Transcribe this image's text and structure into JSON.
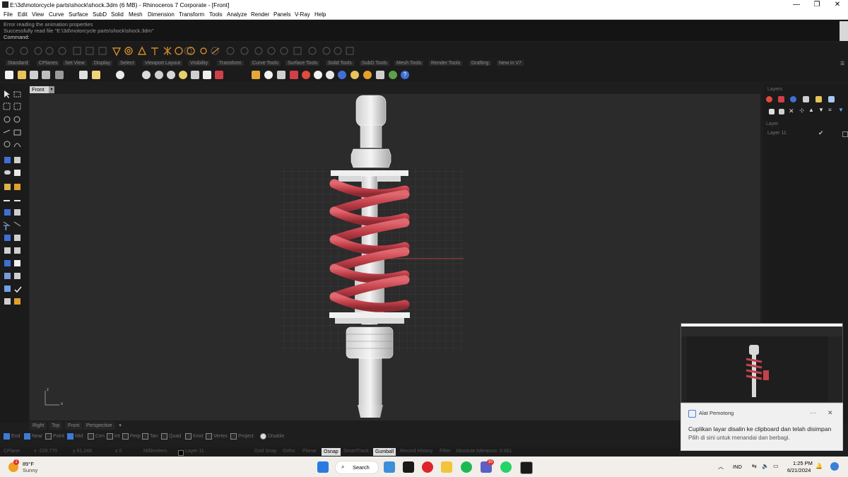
{
  "window": {
    "title": "E:\\3d\\motorcycle parts\\shock\\shock.3dm (6 MB) - Rhinoceros 7 Corporate - [Front]",
    "controls": {
      "minimize": "—",
      "restore": "❐",
      "close": "✕"
    }
  },
  "menu": [
    "File",
    "Edit",
    "View",
    "Curve",
    "Surface",
    "SubD",
    "Solid",
    "Mesh",
    "Dimension",
    "Transform",
    "Tools",
    "Analyze",
    "Render",
    "Panels",
    "V-Ray",
    "Help"
  ],
  "command_history": [
    "Error reading the animation properties",
    "Successfully read file \"E:\\3d\\motorcycle parts\\shock\\shock.3dm\"",
    "Command:"
  ],
  "toolbar_tabs": [
    "Standard",
    "CPlanes",
    "Set View",
    "Display",
    "Select",
    "Viewport Layout",
    "Visibility",
    "Transform",
    "Curve Tools",
    "Surface Tools",
    "Solid Tools",
    "SubD Tools",
    "Mesh Tools",
    "Render Tools",
    "Drafting",
    "New in V7"
  ],
  "viewport": {
    "name": "Front",
    "dropdown": "▾",
    "axis": {
      "y": "z",
      "x": "x"
    },
    "tabs": [
      "Right",
      "Top",
      "Front",
      "Perspective"
    ],
    "add_tab": "+"
  },
  "panel": {
    "tab": "Layers",
    "column_header": "Layer",
    "layers": [
      {
        "name": "Layer 11",
        "check": "✔"
      }
    ]
  },
  "osnap": [
    {
      "label": "End",
      "on": true
    },
    {
      "label": "Near",
      "on": true
    },
    {
      "label": "Point",
      "on": false
    },
    {
      "label": "Mid",
      "on": true
    },
    {
      "label": "Cen",
      "on": false
    },
    {
      "label": "Int",
      "on": false
    },
    {
      "label": "Perp",
      "on": false
    },
    {
      "label": "Tan",
      "on": false
    },
    {
      "label": "Quad",
      "on": false
    },
    {
      "label": "Knot",
      "on": false
    },
    {
      "label": "Vertex",
      "on": false
    },
    {
      "label": "Project",
      "on": false
    },
    {
      "label": "Disable",
      "on": false
    }
  ],
  "status": {
    "cplane": "CPlane",
    "x": "x -228.770",
    "y": "y 81.248",
    "z": "z 0",
    "units": "Millimeters",
    "layer": "Layer 11",
    "grid_snap": "Grid Snap",
    "ortho": "Ortho",
    "planar": "Planar",
    "osnap": "Osnap",
    "smarttrack": "SmartTrack",
    "gumball": "Gumball",
    "record_history": "Record History",
    "filter": "Filter",
    "memory": "Absolute tolerance: 0.001"
  },
  "notification": {
    "app": "Alat Pemotong",
    "more": "···",
    "close": "✕",
    "message": "Cuplikan layar disalin ke clipboard dan telah disimpan",
    "sub": "Pilih di sini untuk menandai dan berbagi."
  },
  "taskbar": {
    "weather_temp": "89°F",
    "weather_cond": "Sunny",
    "weather_badge": "1",
    "search": "Search",
    "lang": "IND",
    "time": "1:25 PM",
    "date": "6/21/2024",
    "teams_badge": "10"
  },
  "colors": {
    "spring": "#c4414b",
    "accent": "#3b7bd8",
    "osnap_active": "#e6e6e6"
  }
}
